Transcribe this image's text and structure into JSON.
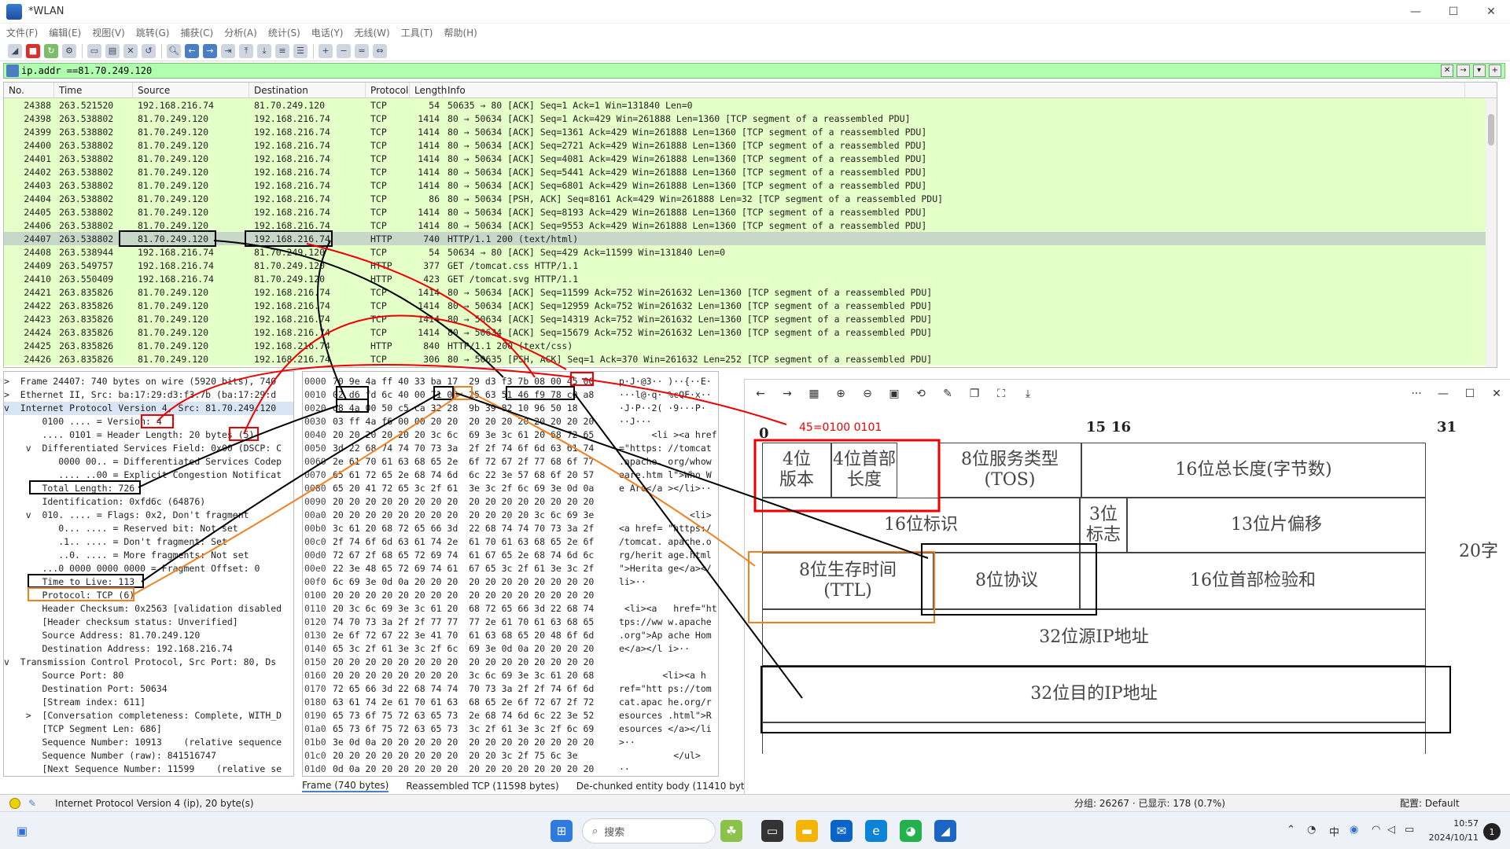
{
  "window": {
    "title": "*WLAN",
    "min": "—",
    "max": "☐",
    "close": "✕"
  },
  "menu": [
    "文件(F)",
    "编辑(E)",
    "视图(V)",
    "跳转(G)",
    "捕获(C)",
    "分析(A)",
    "统计(S)",
    "电话(Y)",
    "无线(W)",
    "工具(T)",
    "帮助(H)"
  ],
  "filter": {
    "value": "ip.addr ==81.70.249.120"
  },
  "columns": [
    "No.",
    "Time",
    "Source",
    "Destination",
    "Protocol",
    "Length",
    "Info"
  ],
  "packets": [
    {
      "no": "24388",
      "time": "263.521520",
      "src": "192.168.216.74",
      "dst": "81.70.249.120",
      "proto": "TCP",
      "len": "54",
      "info": "50635 → 80 [ACK] Seq=1 Ack=1 Win=131840 Len=0"
    },
    {
      "no": "24398",
      "time": "263.538802",
      "src": "81.70.249.120",
      "dst": "192.168.216.74",
      "proto": "TCP",
      "len": "1414",
      "info": "80 → 50634 [ACK] Seq=1 Ack=429 Win=261888 Len=1360 [TCP segment of a reassembled PDU]"
    },
    {
      "no": "24399",
      "time": "263.538802",
      "src": "81.70.249.120",
      "dst": "192.168.216.74",
      "proto": "TCP",
      "len": "1414",
      "info": "80 → 50634 [ACK] Seq=1361 Ack=429 Win=261888 Len=1360 [TCP segment of a reassembled PDU]"
    },
    {
      "no": "24400",
      "time": "263.538802",
      "src": "81.70.249.120",
      "dst": "192.168.216.74",
      "proto": "TCP",
      "len": "1414",
      "info": "80 → 50634 [ACK] Seq=2721 Ack=429 Win=261888 Len=1360 [TCP segment of a reassembled PDU]"
    },
    {
      "no": "24401",
      "time": "263.538802",
      "src": "81.70.249.120",
      "dst": "192.168.216.74",
      "proto": "TCP",
      "len": "1414",
      "info": "80 → 50634 [ACK] Seq=4081 Ack=429 Win=261888 Len=1360 [TCP segment of a reassembled PDU]"
    },
    {
      "no": "24402",
      "time": "263.538802",
      "src": "81.70.249.120",
      "dst": "192.168.216.74",
      "proto": "TCP",
      "len": "1414",
      "info": "80 → 50634 [ACK] Seq=5441 Ack=429 Win=261888 Len=1360 [TCP segment of a reassembled PDU]"
    },
    {
      "no": "24403",
      "time": "263.538802",
      "src": "81.70.249.120",
      "dst": "192.168.216.74",
      "proto": "TCP",
      "len": "1414",
      "info": "80 → 50634 [ACK] Seq=6801 Ack=429 Win=261888 Len=1360 [TCP segment of a reassembled PDU]"
    },
    {
      "no": "24404",
      "time": "263.538802",
      "src": "81.70.249.120",
      "dst": "192.168.216.74",
      "proto": "TCP",
      "len": "86",
      "info": "80 → 50634 [PSH, ACK] Seq=8161 Ack=429 Win=261888 Len=32 [TCP segment of a reassembled PDU]"
    },
    {
      "no": "24405",
      "time": "263.538802",
      "src": "81.70.249.120",
      "dst": "192.168.216.74",
      "proto": "TCP",
      "len": "1414",
      "info": "80 → 50634 [ACK] Seq=8193 Ack=429 Win=261888 Len=1360 [TCP segment of a reassembled PDU]"
    },
    {
      "no": "24406",
      "time": "263.538802",
      "src": "81.70.249.120",
      "dst": "192.168.216.74",
      "proto": "TCP",
      "len": "1414",
      "info": "80 → 50634 [ACK] Seq=9553 Ack=429 Win=261888 Len=1360 [TCP segment of a reassembled PDU]"
    },
    {
      "no": "24407",
      "time": "263.538802",
      "src": "81.70.249.120",
      "dst": "192.168.216.74",
      "proto": "HTTP",
      "len": "740",
      "info": "HTTP/1.1 200   (text/html)"
    },
    {
      "no": "24408",
      "time": "263.538944",
      "src": "192.168.216.74",
      "dst": "81.70.249.120",
      "proto": "TCP",
      "len": "54",
      "info": "50634 → 80 [ACK] Seq=429 Ack=11599 Win=131840 Len=0"
    },
    {
      "no": "24409",
      "time": "263.549757",
      "src": "192.168.216.74",
      "dst": "81.70.249.120",
      "proto": "HTTP",
      "len": "377",
      "info": "GET /tomcat.css HTTP/1.1"
    },
    {
      "no": "24410",
      "time": "263.550409",
      "src": "192.168.216.74",
      "dst": "81.70.249.120",
      "proto": "HTTP",
      "len": "423",
      "info": "GET /tomcat.svg HTTP/1.1"
    },
    {
      "no": "24421",
      "time": "263.835826",
      "src": "81.70.249.120",
      "dst": "192.168.216.74",
      "proto": "TCP",
      "len": "1414",
      "info": "80 → 50634 [ACK] Seq=11599 Ack=752 Win=261632 Len=1360 [TCP segment of a reassembled PDU]"
    },
    {
      "no": "24422",
      "time": "263.835826",
      "src": "81.70.249.120",
      "dst": "192.168.216.74",
      "proto": "TCP",
      "len": "1414",
      "info": "80 → 50634 [ACK] Seq=12959 Ack=752 Win=261632 Len=1360 [TCP segment of a reassembled PDU]"
    },
    {
      "no": "24423",
      "time": "263.835826",
      "src": "81.70.249.120",
      "dst": "192.168.216.74",
      "proto": "TCP",
      "len": "1414",
      "info": "80 → 50634 [ACK] Seq=14319 Ack=752 Win=261632 Len=1360 [TCP segment of a reassembled PDU]"
    },
    {
      "no": "24424",
      "time": "263.835826",
      "src": "81.70.249.120",
      "dst": "192.168.216.74",
      "proto": "TCP",
      "len": "1414",
      "info": "80 → 50634 [ACK] Seq=15679 Ack=752 Win=261632 Len=1360 [TCP segment of a reassembled PDU]"
    },
    {
      "no": "24425",
      "time": "263.835826",
      "src": "81.70.249.120",
      "dst": "192.168.216.74",
      "proto": "HTTP",
      "len": "840",
      "info": "HTTP/1.1 200   (text/css)"
    },
    {
      "no": "24426",
      "time": "263.835826",
      "src": "81.70.249.120",
      "dst": "192.168.216.74",
      "proto": "TCP",
      "len": "306",
      "info": "80 → 50635 [PSH, ACK] Seq=1 Ack=370 Win=261632 Len=252 [TCP segment of a reassembled PDU]"
    }
  ],
  "details": [
    ">  Frame 24407: 740 bytes on wire (5920 bits), 740",
    ">  Ethernet II, Src: ba:17:29:d3:f3:7b (ba:17:29:d",
    "v  Internet Protocol Version 4, Src: 81.70.249.120",
    "       0100 .... = Version: 4",
    "       .... 0101 = Header Length: 20 bytes (5)",
    "    v  Differentiated Services Field: 0x00 (DSCP: C",
    "          0000 00.. = Differentiated Services Codep",
    "          .... ..00 = Explicit Congestion Notificat",
    "       Total Length: 726",
    "       Identification: 0xfd6c (64876)",
    "    v  010. .... = Flags: 0x2, Don't fragment",
    "          0... .... = Reserved bit: Not set",
    "          .1.. .... = Don't fragment: Set",
    "          ..0. .... = More fragments: Not set",
    "       ...0 0000 0000 0000 = Fragment Offset: 0",
    "       Time to Live: 113",
    "       Protocol: TCP (6)",
    "       Header Checksum: 0x2563 [validation disabled",
    "       [Header checksum status: Unverified]",
    "       Source Address: 81.70.249.120",
    "       Destination Address: 192.168.216.74",
    "v  Transmission Control Protocol, Src Port: 80, Ds",
    "       Source Port: 80",
    "       Destination Port: 50634",
    "       [Stream index: 611]",
    "    >  [Conversation completeness: Complete, WITH_D",
    "       [TCP Segment Len: 686]",
    "       Sequence Number: 10913    (relative sequence",
    "       Sequence Number (raw): 841516747",
    "       [Next Sequence Number: 11599    (relative se"
  ],
  "bytes": [
    {
      "off": "0000",
      "hex": "70 9e 4a ff 40 33 ba 17  29 d3 f3 7b 08 00 45 00",
      "asc": "p·J·@3·· )··{··E·"
    },
    {
      "off": "0010",
      "hex": "02 d6 fd 6c 40 00 71 06  25 63 51 46 f9 78 c0 a8",
      "asc": "···l@·q· %cQF·x··"
    },
    {
      "off": "0020",
      "hex": "d8 4a 00 50 c5 ca 32 28  9b 39 82 10 96 50 18",
      "asc": "·J·P··2( ·9···P·"
    },
    {
      "off": "0030",
      "hex": "03 ff 4a f6 00 00 20 20  20 20 20 20 20 20 20 20",
      "asc": "··J···"
    },
    {
      "off": "0040",
      "hex": "20 20 20 20 20 20 3c 6c  69 3e 3c 61 20 68 72 65",
      "asc": "      <li ><a href"
    },
    {
      "off": "0050",
      "hex": "3d 22 68 74 74 70 73 3a  2f 2f 74 6f 6d 63 61 74",
      "asc": "=\"https: //tomcat"
    },
    {
      "off": "0060",
      "hex": "2e 61 70 61 63 68 65 2e  6f 72 67 2f 77 68 6f 77",
      "asc": ".apache. org/whow"
    },
    {
      "off": "0070",
      "hex": "65 61 72 65 2e 68 74 6d  6c 22 3e 57 68 6f 20 57",
      "asc": "eare.htm l\">Who W"
    },
    {
      "off": "0080",
      "hex": "65 20 41 72 65 3c 2f 61  3e 3c 2f 6c 69 3e 0d 0a",
      "asc": "e Are</a ></li>··"
    },
    {
      "off": "0090",
      "hex": "20 20 20 20 20 20 20 20  20 20 20 20 20 20 20 20",
      "asc": ""
    },
    {
      "off": "00a0",
      "hex": "20 20 20 20 20 20 20 20  20 20 20 20 3c 6c 69 3e",
      "asc": "             <li>"
    },
    {
      "off": "00b0",
      "hex": "3c 61 20 68 72 65 66 3d  22 68 74 74 70 73 3a 2f",
      "asc": "<a href= \"https:/"
    },
    {
      "off": "00c0",
      "hex": "2f 74 6f 6d 63 61 74 2e  61 70 61 63 68 65 2e 6f",
      "asc": "/tomcat. apache.o"
    },
    {
      "off": "00d0",
      "hex": "72 67 2f 68 65 72 69 74  61 67 65 2e 68 74 6d 6c",
      "asc": "rg/herit age.html"
    },
    {
      "off": "00e0",
      "hex": "22 3e 48 65 72 69 74 61  67 65 3c 2f 61 3e 3c 2f",
      "asc": "\">Herita ge</a></"
    },
    {
      "off": "00f0",
      "hex": "6c 69 3e 0d 0a 20 20 20  20 20 20 20 20 20 20 20",
      "asc": "li>··"
    },
    {
      "off": "0100",
      "hex": "20 20 20 20 20 20 20 20  20 20 20 20 20 20 20 20",
      "asc": ""
    },
    {
      "off": "0110",
      "hex": "20 3c 6c 69 3e 3c 61 20  68 72 65 66 3d 22 68 74",
      "asc": " <li><a   href=\"ht"
    },
    {
      "off": "0120",
      "hex": "74 70 73 3a 2f 2f 77 77  77 2e 61 70 61 63 68 65",
      "asc": "tps://ww w.apache"
    },
    {
      "off": "0130",
      "hex": "2e 6f 72 67 22 3e 41 70  61 63 68 65 20 48 6f 6d",
      "asc": ".org\">Ap ache Hom"
    },
    {
      "off": "0140",
      "hex": "65 3c 2f 61 3e 3c 2f 6c  69 3e 0d 0a 20 20 20 20",
      "asc": "e</a></l i>··"
    },
    {
      "off": "0150",
      "hex": "20 20 20 20 20 20 20 20  20 20 20 20 20 20 20 20",
      "asc": ""
    },
    {
      "off": "0160",
      "hex": "20 20 20 20 20 20 20 20  3c 6c 69 3e 3c 61 20 68",
      "asc": "        <li><a h"
    },
    {
      "off": "0170",
      "hex": "72 65 66 3d 22 68 74 74  70 73 3a 2f 2f 74 6f 6d",
      "asc": "ref=\"htt ps://tom"
    },
    {
      "off": "0180",
      "hex": "63 61 74 2e 61 70 61 63  68 65 2e 6f 72 67 2f 72",
      "asc": "cat.apac he.org/r"
    },
    {
      "off": "0190",
      "hex": "65 73 6f 75 72 63 65 73  2e 68 74 6d 6c 22 3e 52",
      "asc": "esources .html\">R"
    },
    {
      "off": "01a0",
      "hex": "65 73 6f 75 72 63 65 73  3c 2f 61 3e 3c 2f 6c 69",
      "asc": "esources </a></li"
    },
    {
      "off": "01b0",
      "hex": "3e 0d 0a 20 20 20 20 20  20 20 20 20 20 20 20 20",
      "asc": ">··"
    },
    {
      "off": "01c0",
      "hex": "20 20 20 20 20 20 20 20  20 20 3c 2f 75 6c 3e",
      "asc": "          </ul>"
    },
    {
      "off": "01d0",
      "hex": "0d 0a 20 20 20 20 20 20  20 20 20 20 20 20 20 20",
      "asc": "··"
    },
    {
      "off": "01e0",
      "hex": "20 20 20 20 20 3c 2f 64  69 76 3e 0d 0a 20 20 20",
      "asc": "    </ div>··"
    },
    {
      "off": "01f0",
      "hex": "20 20 20 20 20 20 20 20  20 20 20 20 20 3c 2f",
      "asc": "            </"
    },
    {
      "off": "0200",
      "hex": "64 69 76 3e 0d 0a 20 20  20 20 20 20 20 20 20 20",
      "asc": "div>··"
    },
    {
      "off": "0210",
      "hex": "20 20 20 20 20 20 3c 62  72 20 63 6c 61 73 73 3d",
      "asc": "      <b r class="
    }
  ],
  "pane_tabs": [
    "Frame (740 bytes)",
    "Reassembled TCP (11598 bytes)",
    "De-chunked entity body (11410 bytes)"
  ],
  "status": {
    "message": "Internet Protocol Version 4 (ip), 20 byte(s)",
    "stats": "分组: 26267 · 已显示: 178 (0.7%)",
    "profile": "配置: Default"
  },
  "viewer": {
    "annotation": "45=0100 0101",
    "bits": [
      "0",
      "15",
      "16",
      "31"
    ],
    "cells": {
      "version": "4位\n版本",
      "ihl": "4位首部\n长度",
      "tos": "8位服务类型\n(TOS)",
      "total_len": "16位总长度(字节数)",
      "ident": "16位标识",
      "flags": "3位\n标志",
      "frag": "13位片偏移",
      "ttl": "8位生存时间\n(TTL)",
      "proto": "8位协议",
      "checksum": "16位首部检验和",
      "src": "32位源IP地址",
      "dst": "32位目的IP地址",
      "side": "20字"
    }
  },
  "taskbar": {
    "search": "搜索",
    "time": "10:57",
    "date": "2024/10/11",
    "ime": "中",
    "notif": "1"
  }
}
